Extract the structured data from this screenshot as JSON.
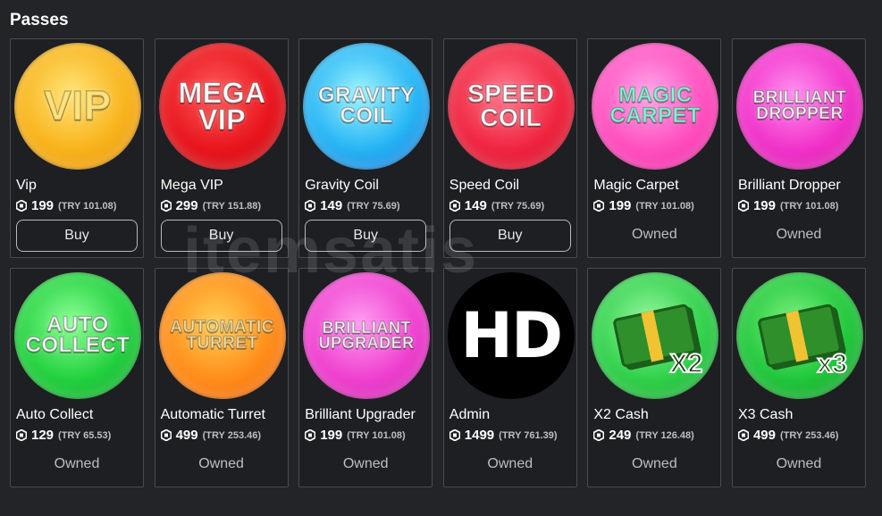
{
  "section": {
    "title": "Passes"
  },
  "buy_label": "Buy",
  "owned_label": "Owned",
  "watermark": "itemsatis",
  "passes": [
    {
      "name": "Vip",
      "price": "199",
      "local": "(TRY 101.08)",
      "art_text": "VIP",
      "status": "buy"
    },
    {
      "name": "Mega VIP",
      "price": "299",
      "local": "(TRY 151.88)",
      "art_text": "MEGA VIP",
      "status": "buy"
    },
    {
      "name": "Gravity Coil",
      "price": "149",
      "local": "(TRY 75.69)",
      "art_text": "GRAVITY COIL",
      "status": "buy"
    },
    {
      "name": "Speed Coil",
      "price": "149",
      "local": "(TRY 75.69)",
      "art_text": "SPEED COIL",
      "status": "buy"
    },
    {
      "name": "Magic Carpet",
      "price": "199",
      "local": "(TRY 101.08)",
      "art_text": "MAGIC CARPET",
      "status": "owned"
    },
    {
      "name": "Brilliant Dropper",
      "price": "199",
      "local": "(TRY 101.08)",
      "art_text": "BRILLIANT DROPPER",
      "status": "owned"
    },
    {
      "name": "Auto Collect",
      "price": "129",
      "local": "(TRY 65.53)",
      "art_text": "AUTO COLLECT",
      "status": "owned"
    },
    {
      "name": "Automatic Turret",
      "price": "499",
      "local": "(TRY 253.46)",
      "art_text": "AUTOMATIC TURRET",
      "status": "owned"
    },
    {
      "name": "Brilliant Upgrader",
      "price": "199",
      "local": "(TRY 101.08)",
      "art_text": "BRILLIANT UPGRADER",
      "status": "owned"
    },
    {
      "name": "Admin",
      "price": "1499",
      "local": "(TRY 761.39)",
      "art_text": "HD",
      "status": "owned"
    },
    {
      "name": "X2 Cash",
      "price": "249",
      "local": "(TRY 126.48)",
      "art_text": "X2",
      "status": "owned"
    },
    {
      "name": "X3 Cash",
      "price": "499",
      "local": "(TRY 253.46)",
      "art_text": "x3",
      "status": "owned"
    }
  ],
  "colors": {
    "background": "#232427",
    "card_border": "#4a4b4f",
    "muted_text": "#bdbec2"
  },
  "icons": {
    "currency": "robux-icon"
  }
}
